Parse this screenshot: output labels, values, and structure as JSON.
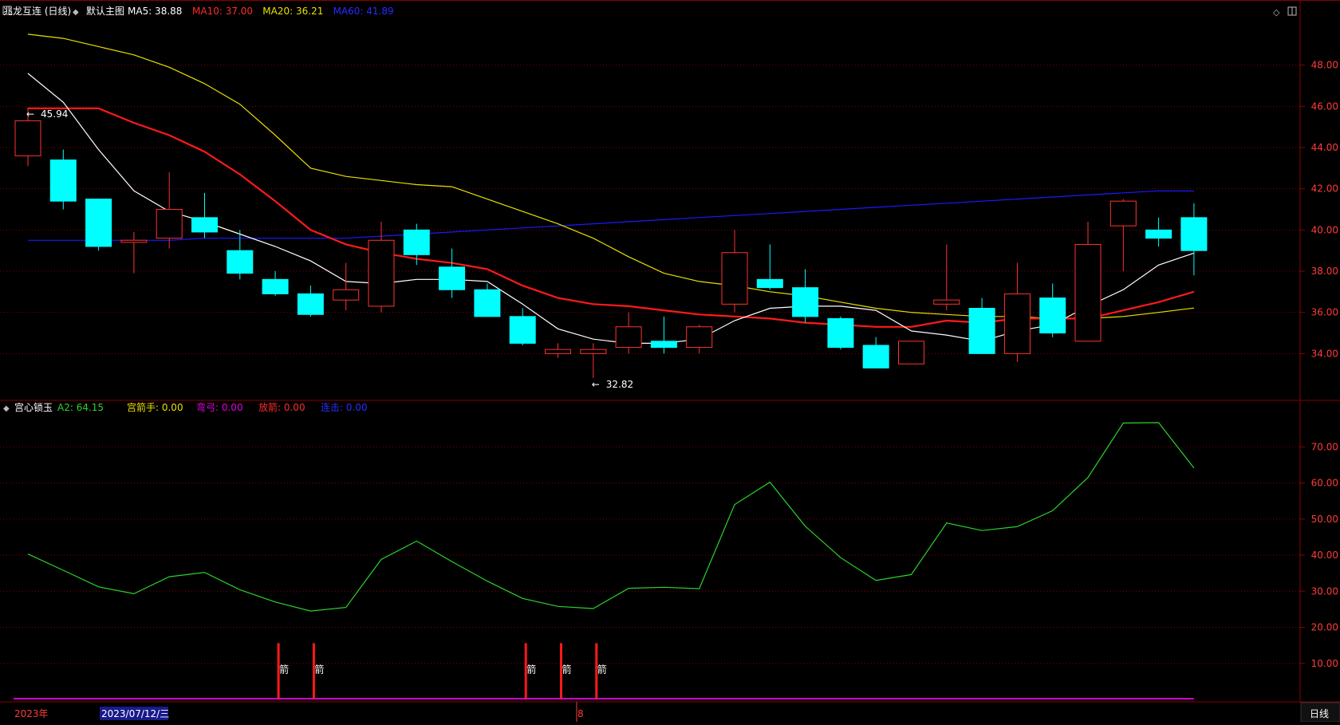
{
  "window": {
    "title": "兆龙互连 (日线)",
    "main_label": "默认主图",
    "period_button": "日线"
  },
  "ma_legend": [
    {
      "label": "MA5: 38.88",
      "color": "#ffffff"
    },
    {
      "label": "MA10: 37.00",
      "color": "#ff2b2b"
    },
    {
      "label": "MA20: 36.21",
      "color": "#e8e000"
    },
    {
      "label": "MA60: 41.89",
      "color": "#2b2bff"
    }
  ],
  "indicator_legend": {
    "name": "宫心锁玉",
    "items": [
      {
        "label": "A2: 64.15",
        "color": "#2bd32b"
      },
      {
        "label": "宫箭手: 0.00",
        "color": "#e8e000"
      },
      {
        "label": "弯弓: 0.00",
        "color": "#e000e0"
      },
      {
        "label": "放箭: 0.00",
        "color": "#ff2b2b"
      },
      {
        "label": "连击: 0.00",
        "color": "#2b2bff"
      }
    ]
  },
  "time_axis": {
    "year_label": "2023年",
    "cursor_date": "2023/07/12/三",
    "month_marker": "8"
  },
  "arrow_glyph": "箭",
  "colors": {
    "up": "#ff3232",
    "down": "#00ffff",
    "ma5": "#ffffff",
    "ma10": "#ff1a1a",
    "ma20": "#e8e000",
    "ma60": "#1a1aff",
    "a2": "#2bd32b",
    "grid": "#8a0000",
    "axis_text": "#ff3b3b"
  },
  "chart_data": [
    {
      "type": "candlestick",
      "ylim": [
        32.0,
        50.0
      ],
      "y_ticks": [
        "34.00",
        "36.00",
        "38.00",
        "40.00",
        "42.00",
        "44.00",
        "46.00",
        "48.00"
      ],
      "annotations": [
        {
          "text": "45.94",
          "bar": 0,
          "price": 45.94
        },
        {
          "text": "32.82",
          "bar": 16,
          "price": 32.82
        }
      ],
      "candles": [
        {
          "o": 43.6,
          "h": 45.94,
          "l": 43.1,
          "c": 45.3
        },
        {
          "o": 43.4,
          "h": 43.9,
          "l": 41.0,
          "c": 41.4
        },
        {
          "o": 41.5,
          "h": 41.5,
          "l": 39.0,
          "c": 39.2
        },
        {
          "o": 39.4,
          "h": 39.9,
          "l": 37.9,
          "c": 39.5
        },
        {
          "o": 39.6,
          "h": 42.8,
          "l": 39.1,
          "c": 41.0
        },
        {
          "o": 40.6,
          "h": 41.8,
          "l": 39.6,
          "c": 39.9
        },
        {
          "o": 39.0,
          "h": 40.0,
          "l": 37.6,
          "c": 37.9
        },
        {
          "o": 37.6,
          "h": 38.0,
          "l": 36.8,
          "c": 36.9
        },
        {
          "o": 36.9,
          "h": 37.3,
          "l": 35.8,
          "c": 35.9
        },
        {
          "o": 36.6,
          "h": 38.4,
          "l": 36.1,
          "c": 37.1
        },
        {
          "o": 36.3,
          "h": 40.4,
          "l": 36.0,
          "c": 39.5
        },
        {
          "o": 40.0,
          "h": 40.3,
          "l": 38.3,
          "c": 38.8
        },
        {
          "o": 38.2,
          "h": 39.1,
          "l": 36.7,
          "c": 37.1
        },
        {
          "o": 37.1,
          "h": 37.4,
          "l": 35.8,
          "c": 35.8
        },
        {
          "o": 35.8,
          "h": 36.2,
          "l": 34.4,
          "c": 34.5
        },
        {
          "o": 34.0,
          "h": 34.5,
          "l": 33.8,
          "c": 34.2
        },
        {
          "o": 34.0,
          "h": 34.5,
          "l": 32.82,
          "c": 34.2
        },
        {
          "o": 34.3,
          "h": 36.0,
          "l": 34.0,
          "c": 35.3
        },
        {
          "o": 34.6,
          "h": 35.8,
          "l": 34.0,
          "c": 34.3
        },
        {
          "o": 34.3,
          "h": 35.4,
          "l": 34.0,
          "c": 35.3
        },
        {
          "o": 36.4,
          "h": 40.0,
          "l": 36.0,
          "c": 38.9
        },
        {
          "o": 37.6,
          "h": 39.3,
          "l": 37.1,
          "c": 37.2
        },
        {
          "o": 37.2,
          "h": 38.1,
          "l": 35.5,
          "c": 35.8
        },
        {
          "o": 35.7,
          "h": 35.8,
          "l": 34.2,
          "c": 34.3
        },
        {
          "o": 34.4,
          "h": 34.8,
          "l": 33.3,
          "c": 33.3
        },
        {
          "o": 33.5,
          "h": 34.6,
          "l": 33.5,
          "c": 34.6
        },
        {
          "o": 36.4,
          "h": 39.3,
          "l": 36.1,
          "c": 36.6
        },
        {
          "o": 36.2,
          "h": 36.7,
          "l": 34.0,
          "c": 34.0
        },
        {
          "o": 34.0,
          "h": 38.4,
          "l": 33.6,
          "c": 36.9
        },
        {
          "o": 36.7,
          "h": 37.4,
          "l": 34.8,
          "c": 35.0
        },
        {
          "o": 34.6,
          "h": 40.4,
          "l": 34.6,
          "c": 39.3
        },
        {
          "o": 40.2,
          "h": 41.5,
          "l": 38.0,
          "c": 41.4
        },
        {
          "o": 40.0,
          "h": 40.6,
          "l": 39.2,
          "c": 39.6
        },
        {
          "o": 40.6,
          "h": 41.3,
          "l": 37.8,
          "c": 39.0
        }
      ],
      "ma5": [
        47.6,
        46.2,
        43.9,
        41.9,
        40.9,
        40.4,
        39.8,
        39.2,
        38.5,
        37.5,
        37.4,
        37.6,
        37.6,
        37.5,
        36.4,
        35.2,
        34.7,
        34.5,
        34.5,
        34.7,
        35.6,
        36.2,
        36.3,
        36.3,
        36.1,
        35.1,
        34.9,
        34.6,
        35.1,
        35.4,
        36.3,
        37.1,
        38.3,
        38.88
      ],
      "ma10": [
        45.9,
        45.9,
        45.9,
        45.2,
        44.6,
        43.8,
        42.7,
        41.4,
        40.0,
        39.3,
        38.9,
        38.6,
        38.4,
        38.1,
        37.3,
        36.7,
        36.4,
        36.3,
        36.1,
        35.9,
        35.8,
        35.7,
        35.5,
        35.4,
        35.3,
        35.3,
        35.6,
        35.5,
        35.7,
        35.7,
        35.7,
        36.1,
        36.5,
        37.0
      ],
      "ma20": [
        49.5,
        49.3,
        48.9,
        48.5,
        47.9,
        47.1,
        46.1,
        44.6,
        43.0,
        42.6,
        42.4,
        42.2,
        42.1,
        41.5,
        40.9,
        40.3,
        39.6,
        38.7,
        37.9,
        37.5,
        37.3,
        37.0,
        36.8,
        36.5,
        36.2,
        36.0,
        35.9,
        35.8,
        35.8,
        35.7,
        35.7,
        35.8,
        36.0,
        36.21
      ],
      "ma60": [
        39.5,
        39.5,
        39.5,
        39.5,
        39.5,
        39.6,
        39.6,
        39.6,
        39.6,
        39.6,
        39.7,
        39.8,
        39.9,
        40.0,
        40.1,
        40.2,
        40.3,
        40.4,
        40.5,
        40.6,
        40.7,
        40.8,
        40.9,
        41.0,
        41.1,
        41.2,
        41.3,
        41.4,
        41.5,
        41.6,
        41.7,
        41.8,
        41.9,
        41.89
      ]
    },
    {
      "type": "line",
      "ylim": [
        0,
        80
      ],
      "y_ticks": [
        "10.00",
        "20.00",
        "30.00",
        "40.00",
        "50.00",
        "60.00",
        "70.00"
      ],
      "series": [
        {
          "name": "A2",
          "values": [
            40.3,
            35.8,
            31.2,
            29.3,
            34.0,
            35.2,
            30.4,
            27.0,
            24.5,
            25.5,
            38.8,
            43.9,
            38.2,
            32.8,
            28.0,
            25.8,
            25.2,
            30.8,
            31.1,
            30.7,
            54.0,
            60.2,
            48.0,
            39.3,
            33.0,
            34.6,
            48.9,
            46.8,
            47.9,
            52.3,
            61.5,
            76.6,
            76.7,
            64.15
          ]
        }
      ],
      "arrow_bars": [
        7,
        8,
        14,
        15,
        16
      ]
    }
  ]
}
